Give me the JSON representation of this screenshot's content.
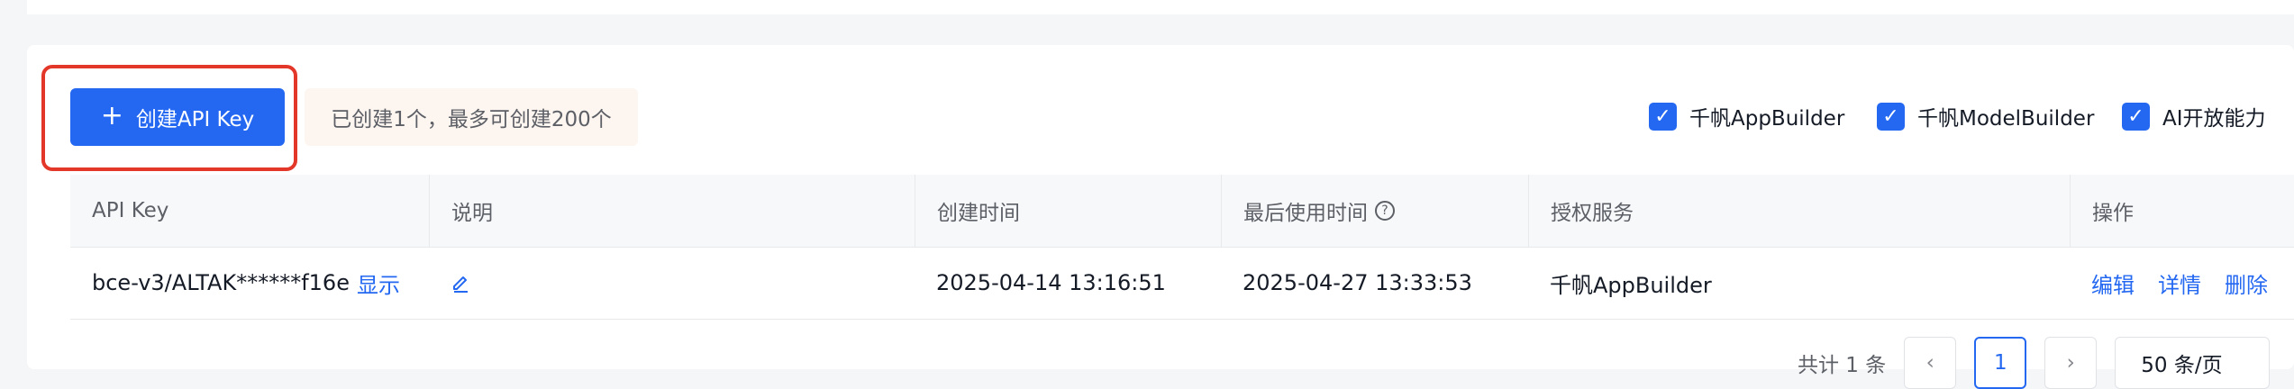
{
  "toolbar": {
    "create_button_label": "创建API Key",
    "quota_text": "已创建1个，最多可创建200个"
  },
  "filters": [
    {
      "label": "千帆AppBuilder",
      "checked": true
    },
    {
      "label": "千帆ModelBuilder",
      "checked": true
    },
    {
      "label": "AI开放能力",
      "checked": true
    }
  ],
  "table": {
    "headers": {
      "api_key": "API Key",
      "description": "说明",
      "created": "创建时间",
      "last_used": "最后使用时间",
      "services": "授权服务",
      "actions": "操作"
    },
    "rows": [
      {
        "api_key": "bce-v3/ALTAK******f16e",
        "show_label": "显示",
        "created": "2025-04-14 13:16:51",
        "last_used": "2025-04-27 13:33:53",
        "services": "千帆AppBuilder",
        "edit_label": "编辑",
        "detail_label": "详情",
        "delete_label": "删除"
      }
    ]
  },
  "pagination": {
    "total_text": "共计 1 条",
    "prev_icon": "chevron-left-icon",
    "current_page": "1",
    "next_icon": "chevron-right-icon",
    "page_size": "50 条/页"
  },
  "colors": {
    "accent": "#2468f2",
    "highlight": "#e3372a",
    "quota_bg": "#fdf5ef"
  }
}
